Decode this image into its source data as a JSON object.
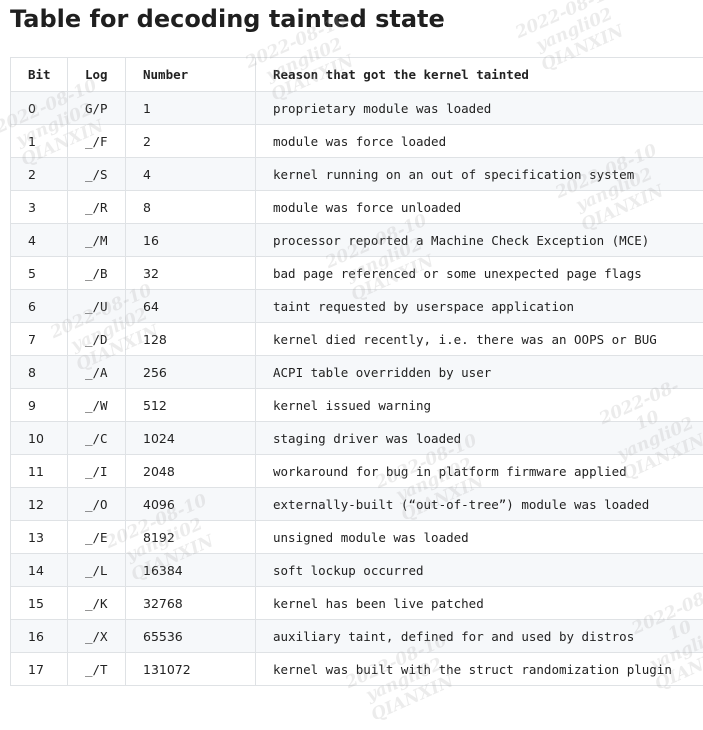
{
  "title": "Table for decoding tainted state",
  "headers": [
    "Bit",
    "Log",
    "Number",
    "Reason that got the kernel tainted"
  ],
  "rows": [
    {
      "bit": "0",
      "log": "G/P",
      "number": "1",
      "reason": "proprietary module was loaded"
    },
    {
      "bit": "1",
      "log": "_/F",
      "number": "2",
      "reason": "module was force loaded"
    },
    {
      "bit": "2",
      "log": "_/S",
      "number": "4",
      "reason": "kernel running on an out of specification system"
    },
    {
      "bit": "3",
      "log": "_/R",
      "number": "8",
      "reason": "module was force unloaded"
    },
    {
      "bit": "4",
      "log": "_/M",
      "number": "16",
      "reason": "processor reported a Machine Check Exception (MCE)"
    },
    {
      "bit": "5",
      "log": "_/B",
      "number": "32",
      "reason": "bad page referenced or some unexpected page flags"
    },
    {
      "bit": "6",
      "log": "_/U",
      "number": "64",
      "reason": "taint requested by userspace application"
    },
    {
      "bit": "7",
      "log": "_/D",
      "number": "128",
      "reason": "kernel died recently, i.e. there was an OOPS or BUG"
    },
    {
      "bit": "8",
      "log": "_/A",
      "number": "256",
      "reason": "ACPI table overridden by user"
    },
    {
      "bit": "9",
      "log": "_/W",
      "number": "512",
      "reason": "kernel issued warning"
    },
    {
      "bit": "10",
      "log": "_/C",
      "number": "1024",
      "reason": "staging driver was loaded"
    },
    {
      "bit": "11",
      "log": "_/I",
      "number": "2048",
      "reason": "workaround for bug in platform firmware applied"
    },
    {
      "bit": "12",
      "log": "_/O",
      "number": "4096",
      "reason": "externally-built (“out-of-tree”) module was loaded"
    },
    {
      "bit": "13",
      "log": "_/E",
      "number": "8192",
      "reason": "unsigned module was loaded"
    },
    {
      "bit": "14",
      "log": "_/L",
      "number": "16384",
      "reason": "soft lockup occurred"
    },
    {
      "bit": "15",
      "log": "_/K",
      "number": "32768",
      "reason": "kernel has been live patched"
    },
    {
      "bit": "16",
      "log": "_/X",
      "number": "65536",
      "reason": "auxiliary taint, defined for and used by distros"
    },
    {
      "bit": "17",
      "log": "_/T",
      "number": "131072",
      "reason": "kernel was built with the struct randomization plugin"
    }
  ],
  "watermark": {
    "date": "2022-08-10",
    "user": "yangli02",
    "org": "QIANXIN"
  }
}
